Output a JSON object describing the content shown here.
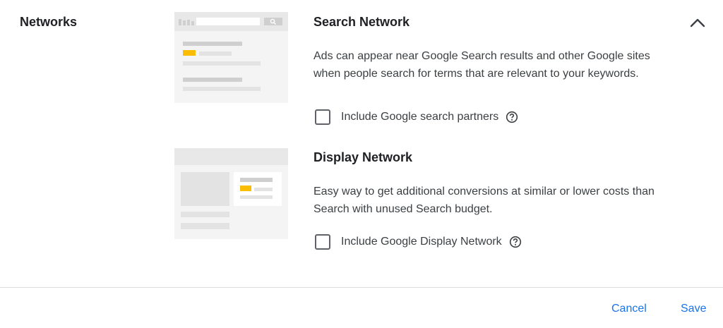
{
  "section": {
    "title": "Networks"
  },
  "icons": {
    "collapse": "chevron-up-icon",
    "help": "help-circle-icon",
    "search_magnifier": "search-icon"
  },
  "search_network": {
    "title": "Search Network",
    "description": "Ads can appear near Google Search results and other Google sites when people search for terms that are relevant to your keywords.",
    "checkbox_label": "Include Google search partners",
    "checked": false
  },
  "display_network": {
    "title": "Display Network",
    "description": "Easy way to get additional conversions at similar or lower costs than Search with unused Search budget.",
    "checkbox_label": "Include Google Display Network",
    "checked": false
  },
  "footer": {
    "cancel_label": "Cancel",
    "save_label": "Save"
  },
  "colors": {
    "accent": "#1a73e8",
    "highlight": "#fbbc04",
    "text": "#3c4043",
    "illustration_bg": "#f4f4f4"
  }
}
